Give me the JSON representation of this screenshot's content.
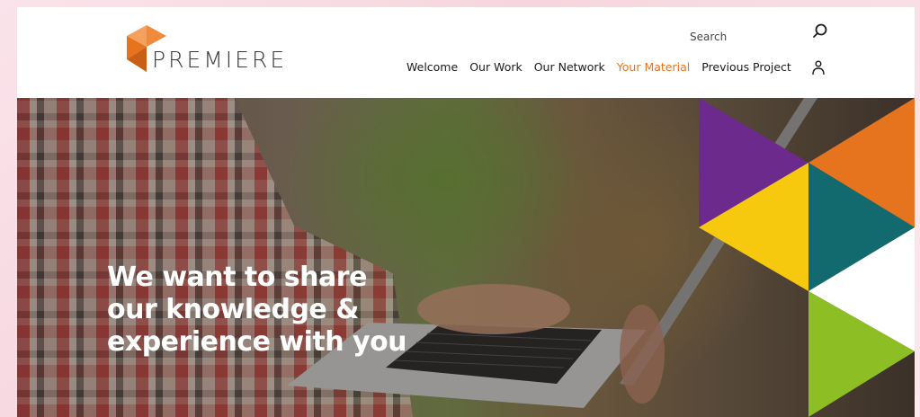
{
  "brand": {
    "name": "PREMIERE",
    "colors": {
      "orange": "#e6731d",
      "purple": "#6b2a8c",
      "teal": "#126a6e",
      "yellow": "#f6c90e",
      "green": "#8dbf25",
      "text": "#1a1a1a"
    }
  },
  "header": {
    "search_label": "Search",
    "search_icon": "search-icon",
    "user_icon": "user-icon"
  },
  "nav": {
    "items": [
      {
        "label": "Welcome",
        "active": false
      },
      {
        "label": "Our Work",
        "active": false
      },
      {
        "label": "Our Network",
        "active": false
      },
      {
        "label": "Your Material",
        "active": true
      },
      {
        "label": "Previous Project",
        "active": false
      }
    ]
  },
  "hero": {
    "headline": [
      "We want to share",
      "our knowledge &",
      "experience with you"
    ]
  }
}
